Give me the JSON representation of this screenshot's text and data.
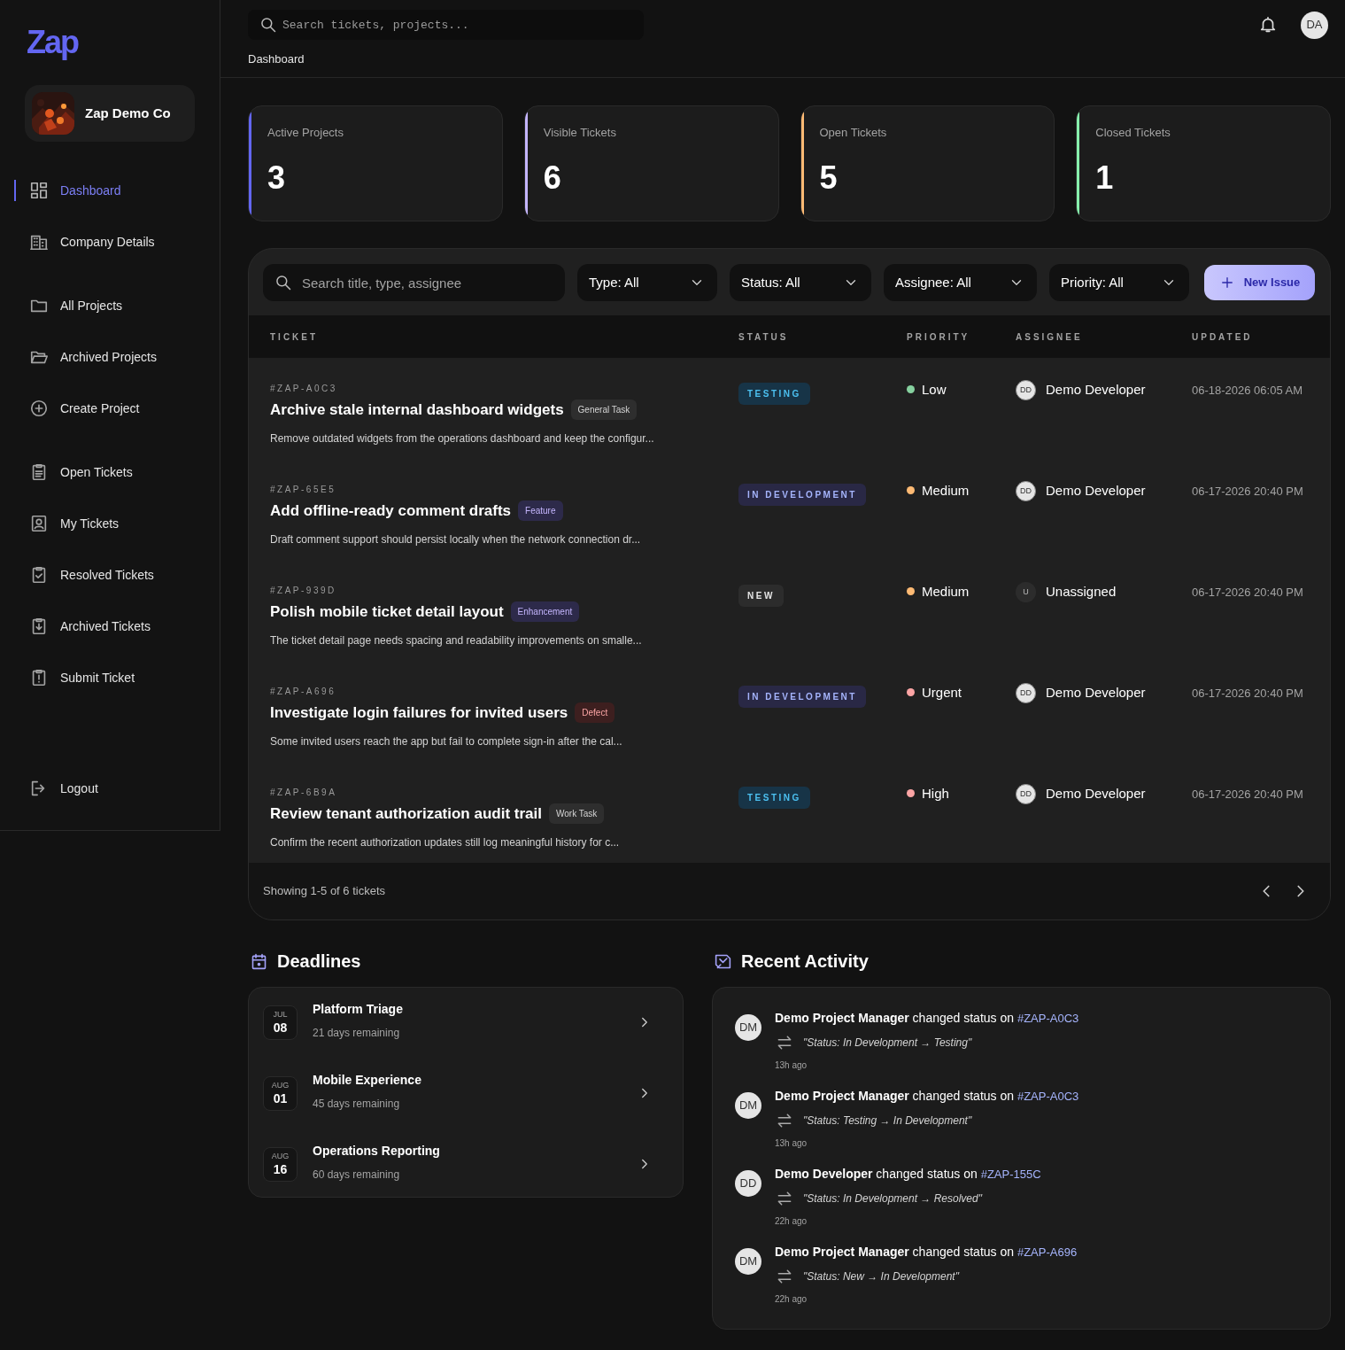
{
  "sidebar": {
    "logo": "Zap",
    "company": {
      "name": "Zap Demo Co"
    },
    "nav_groups": [
      [
        {
          "label": "Dashboard",
          "selected": true
        },
        {
          "label": "Company Details",
          "selected": false
        }
      ],
      [
        {
          "label": "All Projects",
          "selected": false
        },
        {
          "label": "Archived Projects",
          "selected": false
        },
        {
          "label": "Create Project",
          "selected": false
        }
      ],
      [
        {
          "label": "Open Tickets",
          "selected": false
        },
        {
          "label": "My Tickets",
          "selected": false
        },
        {
          "label": "Resolved Tickets",
          "selected": false
        },
        {
          "label": "Archived Tickets",
          "selected": false
        },
        {
          "label": "Submit Ticket",
          "selected": false
        }
      ]
    ],
    "logout": "Logout"
  },
  "top_bar": {
    "search": {
      "placeholder": "Search tickets, projects..."
    },
    "avatar": "DA",
    "breadcrumb": "Dashboard"
  },
  "stats": [
    {
      "label": "Active Projects",
      "value": "3",
      "color": "#6366f1"
    },
    {
      "label": "Visible Tickets",
      "value": "6",
      "color": "#c4b5fd"
    },
    {
      "label": "Open Tickets",
      "value": "5",
      "color": "#fdba74"
    },
    {
      "label": "Closed Tickets",
      "value": "1",
      "color": "#86efac"
    }
  ],
  "tickets": {
    "search": {
      "placeholder": "Search title, type, assignee"
    },
    "filters": [
      "Type: All",
      "Status: All",
      "Assignee: All",
      "Priority: All"
    ],
    "new_button": "New Issue",
    "columns": [
      "TICKET",
      "STATUS",
      "PRIORITY",
      "ASSIGNEE",
      "UPDATED"
    ],
    "rows": [
      {
        "id": "#ZAP-A0C3",
        "title": "Archive stale internal dashboard widgets",
        "tag": {
          "label": "General Task",
          "kind": "task"
        },
        "description": "Remove outdated widgets from the operations dashboard and keep the configur...",
        "status": {
          "label": "TESTING",
          "kind": "testing"
        },
        "priority": {
          "label": "Low",
          "color": "#86d19f"
        },
        "assignee": {
          "initials": "DD",
          "name": "Demo Developer",
          "kind": "user"
        },
        "updated": "06-18-2026 06:05 AM"
      },
      {
        "id": "#ZAP-65E5",
        "title": "Add offline-ready comment drafts",
        "tag": {
          "label": "Feature",
          "kind": "feature"
        },
        "description": "Draft comment support should persist locally when the network connection dr...",
        "status": {
          "label": "IN DEVELOPMENT",
          "kind": "development"
        },
        "priority": {
          "label": "Medium",
          "color": "#fdba74"
        },
        "assignee": {
          "initials": "DD",
          "name": "Demo Developer",
          "kind": "user"
        },
        "updated": "06-17-2026 20:40 PM"
      },
      {
        "id": "#ZAP-939D",
        "title": "Polish mobile ticket detail layout",
        "tag": {
          "label": "Enhancement",
          "kind": "feature"
        },
        "description": "The ticket detail page needs spacing and readability improvements on smalle...",
        "status": {
          "label": "NEW",
          "kind": "new"
        },
        "priority": {
          "label": "Medium",
          "color": "#fdba74"
        },
        "assignee": {
          "initials": "U",
          "name": "Unassigned",
          "kind": "unassigned"
        },
        "updated": "06-17-2026 20:40 PM"
      },
      {
        "id": "#ZAP-A696",
        "title": "Investigate login failures for invited users",
        "tag": {
          "label": "Defect",
          "kind": "defect"
        },
        "description": "Some invited users reach the app but fail to complete sign-in after the cal...",
        "status": {
          "label": "IN DEVELOPMENT",
          "kind": "development"
        },
        "priority": {
          "label": "Urgent",
          "color": "#fca5a5"
        },
        "assignee": {
          "initials": "DD",
          "name": "Demo Developer",
          "kind": "user"
        },
        "updated": "06-17-2026 20:40 PM"
      },
      {
        "id": "#ZAP-6B9A",
        "title": "Review tenant authorization audit trail",
        "tag": {
          "label": "Work Task",
          "kind": "task"
        },
        "description": "Confirm the recent authorization updates still log meaningful history for c...",
        "status": {
          "label": "TESTING",
          "kind": "testing"
        },
        "priority": {
          "label": "High",
          "color": "#fca5a5"
        },
        "assignee": {
          "initials": "DD",
          "name": "Demo Developer",
          "kind": "user"
        },
        "updated": "06-17-2026 20:40 PM"
      }
    ],
    "footer": "Showing 1-5 of 6 tickets"
  },
  "deadlines": {
    "title": "Deadlines",
    "items": [
      {
        "month": "JUL",
        "day": "08",
        "name": "Platform Triage",
        "remaining": "21 days remaining"
      },
      {
        "month": "AUG",
        "day": "01",
        "name": "Mobile Experience",
        "remaining": "45 days remaining"
      },
      {
        "month": "AUG",
        "day": "16",
        "name": "Operations Reporting",
        "remaining": "60 days remaining"
      }
    ]
  },
  "activity": {
    "title": "Recent Activity",
    "items": [
      {
        "initials": "DM",
        "actor": "Demo Project Manager",
        "action": "changed status on",
        "ticket": "#ZAP-A0C3",
        "change": "\"Status: In Development → Testing\"",
        "time": "13h ago"
      },
      {
        "initials": "DM",
        "actor": "Demo Project Manager",
        "action": "changed status on",
        "ticket": "#ZAP-A0C3",
        "change": "\"Status: Testing → In Development\"",
        "time": "13h ago"
      },
      {
        "initials": "DD",
        "actor": "Demo Developer",
        "action": "changed status on",
        "ticket": "#ZAP-155C",
        "change": "\"Status: In Development → Resolved\"",
        "time": "22h ago"
      },
      {
        "initials": "DM",
        "actor": "Demo Project Manager",
        "action": "changed status on",
        "ticket": "#ZAP-A696",
        "change": "\"Status: New → In Development\"",
        "time": "22h ago"
      }
    ]
  }
}
